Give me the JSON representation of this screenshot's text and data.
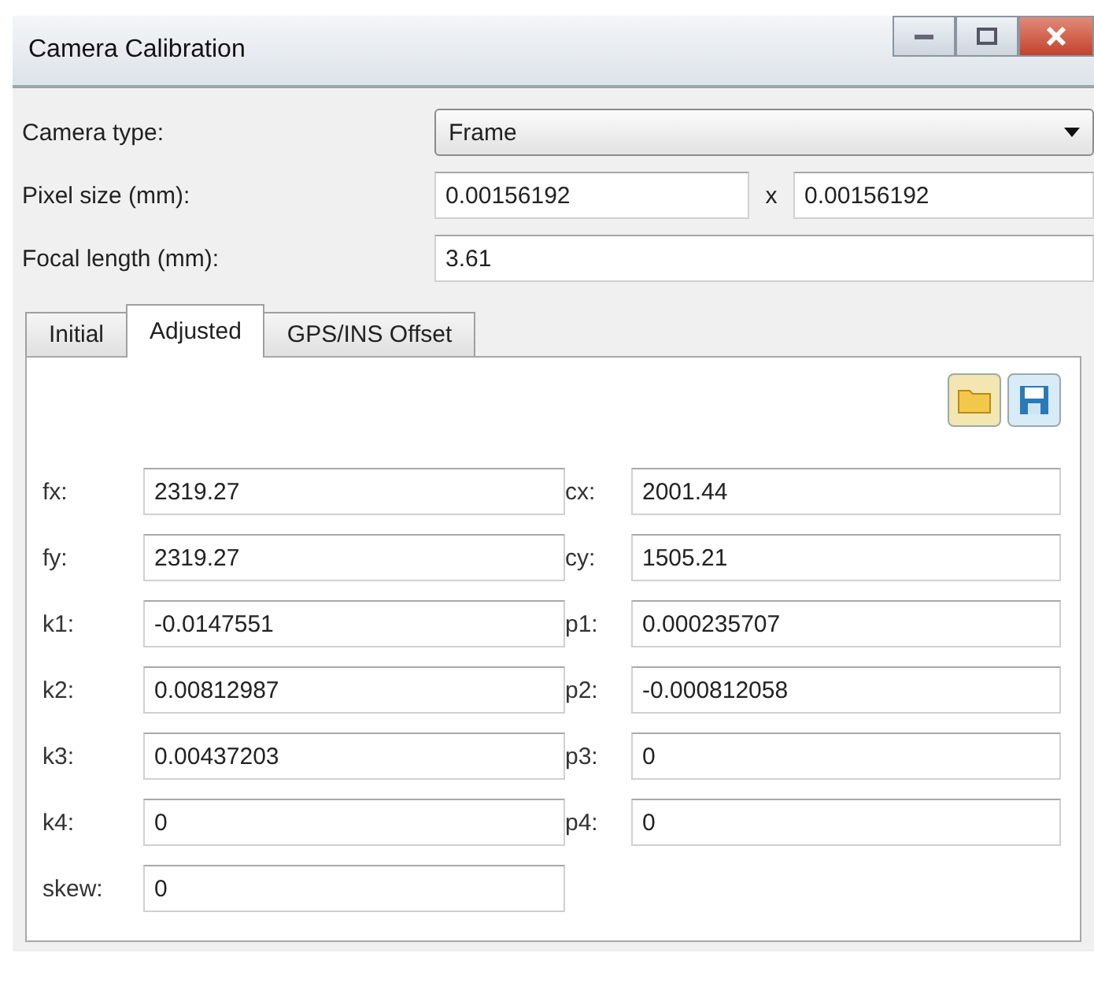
{
  "window": {
    "title": "Camera Calibration"
  },
  "camera_type": {
    "label": "Camera type:",
    "value": "Frame"
  },
  "pixel_size": {
    "label": "Pixel size (mm):",
    "x_value": "0.00156192",
    "separator": "x",
    "y_value": "0.00156192"
  },
  "focal_length": {
    "label": "Focal length (mm):",
    "value": "3.61"
  },
  "tabs": [
    {
      "label": "Initial",
      "selected": false
    },
    {
      "label": "Adjusted",
      "selected": true
    },
    {
      "label": "GPS/INS Offset",
      "selected": false
    }
  ],
  "parameters": [
    {
      "left": {
        "label": "fx:",
        "value": "2319.27"
      },
      "right": {
        "label": "cx:",
        "value": "2001.44"
      }
    },
    {
      "left": {
        "label": "fy:",
        "value": "2319.27"
      },
      "right": {
        "label": "cy:",
        "value": "1505.21"
      }
    },
    {
      "left": {
        "label": "k1:",
        "value": "-0.0147551"
      },
      "right": {
        "label": "p1:",
        "value": "0.000235707"
      }
    },
    {
      "left": {
        "label": "k2:",
        "value": "0.00812987"
      },
      "right": {
        "label": "p2:",
        "value": "-0.000812058"
      }
    },
    {
      "left": {
        "label": "k3:",
        "value": "0.00437203"
      },
      "right": {
        "label": "p3:",
        "value": "0"
      }
    },
    {
      "left": {
        "label": "k4:",
        "value": "0"
      },
      "right": {
        "label": "p4:",
        "value": "0"
      }
    },
    {
      "left": {
        "label": "skew:",
        "value": "0"
      }
    }
  ]
}
